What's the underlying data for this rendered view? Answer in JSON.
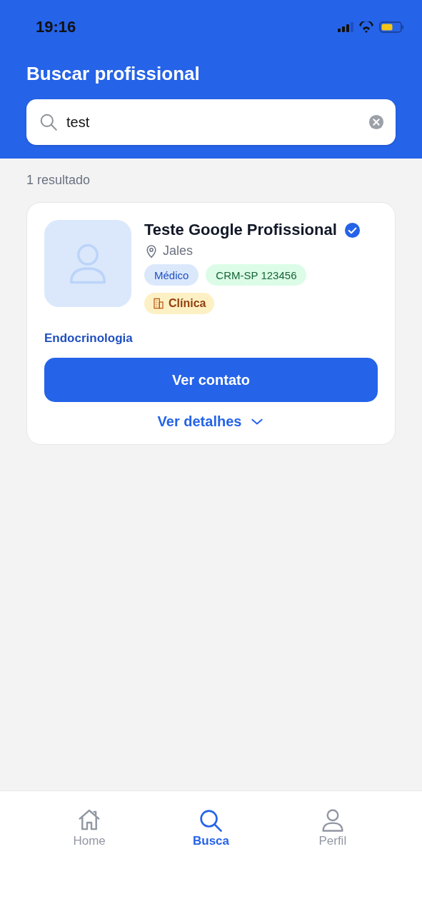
{
  "status_bar": {
    "time": "19:16"
  },
  "header": {
    "title": "Buscar profissional"
  },
  "search": {
    "value": "test"
  },
  "results_count": "1 resultado",
  "results": [
    {
      "name": "Teste Google Profissional",
      "verified": true,
      "location": "Jales",
      "tags": [
        {
          "kind": "role",
          "label": "Médico"
        },
        {
          "kind": "license",
          "label": "CRM-SP 123456"
        },
        {
          "kind": "clinic",
          "label": "Clínica"
        }
      ],
      "specialty": "Endocrinologia",
      "contact_button": "Ver contato",
      "details_link": "Ver detalhes",
      "expanded": false
    }
  ],
  "tab_bar": [
    {
      "kind": "home",
      "label": "Home",
      "selected": false
    },
    {
      "kind": "search",
      "label": "Busca",
      "selected": true
    },
    {
      "kind": "profile",
      "label": "Perfil",
      "selected": false
    }
  ]
}
